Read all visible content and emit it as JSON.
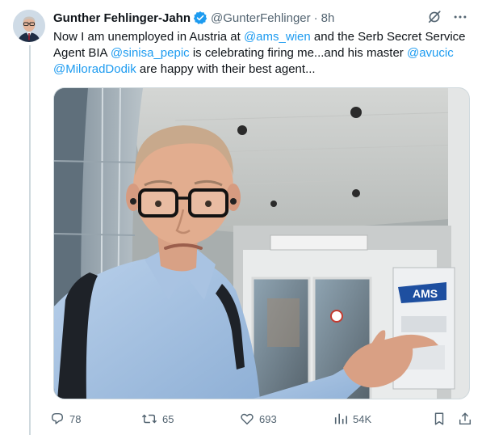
{
  "author": {
    "name": "Gunther Fehlinger-Jahn",
    "handle": "@GunterFehlinger",
    "separator": "·",
    "time": "8h"
  },
  "tweet": {
    "t1": "Now I am unemployed in Austria at ",
    "m1": "@ams_wien",
    "t2": " and the Serb Secret Service Agent BIA ",
    "m2": "@sinisa_pepic",
    "t3": " is celebrating firing me...and his master ",
    "m3": "@avucic",
    "t4": " ",
    "m4": "@MiloradDodik",
    "t5": " are happy with their best agent..."
  },
  "media": {
    "sign_text": "AMS"
  },
  "actions": {
    "replies": "78",
    "reposts": "65",
    "likes": "693",
    "views": "54K"
  },
  "icons": {
    "verified": "verified-badge-icon",
    "grok": "grok-icon",
    "more": "more-icon",
    "reply": "reply-icon",
    "repost": "repost-icon",
    "like": "like-icon",
    "views": "views-icon",
    "bookmark": "bookmark-icon",
    "share": "share-icon"
  },
  "colors": {
    "accent": "#1d9bf0",
    "text": "#0f1419",
    "muted": "#536471"
  }
}
